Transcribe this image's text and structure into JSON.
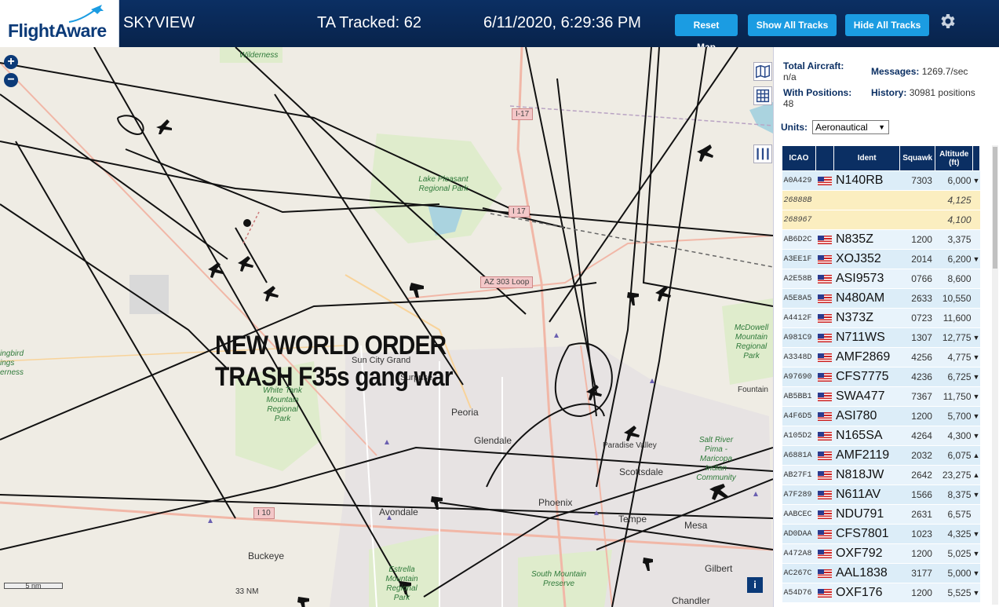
{
  "header": {
    "logo": "FlightAware",
    "title": "SKYVIEW",
    "tracked": "TA Tracked: 62",
    "datetime": "6/11/2020, 6:29:36 PM",
    "buttons": {
      "reset": "Reset Map",
      "show_all": "Show All Tracks",
      "hide_all": "Hide All Tracks"
    },
    "settings_icon": "gear-icon"
  },
  "map": {
    "overlay_text": [
      "NEW WORLD ORDER",
      "TRASH F35s gang war"
    ],
    "zoom_in": "+",
    "zoom_out": "−",
    "scale_km": "5 nm",
    "scale_nm": "33 NM",
    "info": "i",
    "labels": {
      "sun_city_grand": "Sun City Grand",
      "surprise": "Surprise",
      "peoria": "Peoria",
      "glendale": "Glendale",
      "phoenix": "Phoenix",
      "avondale": "Avondale",
      "buckeye": "Buckeye",
      "tempe": "Tempe",
      "mesa": "Mesa",
      "scottsdale": "Scottsdale",
      "paradise_valley": "Paradise Valley",
      "fountain": "Fountain",
      "gilbert": "Gilbert",
      "chandler": "Chandler"
    },
    "parks": {
      "wilderness": "Wilderness",
      "lake_pleasant": "Lake Pleasant Regional Park",
      "white_tank": "White Tank Mountain Regional Park",
      "mcdowell": "McDowell Mountain Regional Park",
      "salt_river": "Salt River Pima - Maricopa Indian Community",
      "estrella": "Estrella Mountain Regional Park",
      "south_mountain": "South Mountain Preserve",
      "hummingbird": "ingbird ings erness"
    },
    "shields": {
      "i17_a": "I-17",
      "i17_b": "I 17",
      "az303": "AZ 303 Loop",
      "i10": "I 10"
    }
  },
  "panel": {
    "total_aircraft_label": "Total Aircraft:",
    "total_aircraft_value": "n/a",
    "with_positions_label": "With Positions:",
    "with_positions_value": "48",
    "messages_label": "Messages:",
    "messages_value": "1269.7/sec",
    "history_label": "History:",
    "history_value": "30981 positions",
    "units_label": "Units:",
    "units_value": "Aeronautical",
    "table": {
      "headers": {
        "icao": "ICAO",
        "ident": "Ident",
        "squawk": "Squawk",
        "altitude": "Altitude (ft)"
      },
      "rows": [
        {
          "icao": "A0A429",
          "ident": "N140RB",
          "squawk": "7303",
          "alt": "6,000",
          "vr": "▼",
          "pos": true
        },
        {
          "icao": "26888B",
          "ident": "",
          "squawk": "",
          "alt": "4,125",
          "vr": "",
          "pos": false
        },
        {
          "icao": "268967",
          "ident": "",
          "squawk": "",
          "alt": "4,100",
          "vr": "",
          "pos": false
        },
        {
          "icao": "AB6D2C",
          "ident": "N835Z",
          "squawk": "1200",
          "alt": "3,375",
          "vr": "",
          "pos": true
        },
        {
          "icao": "A3EE1F",
          "ident": "XOJ352",
          "squawk": "2014",
          "alt": "6,200",
          "vr": "▼",
          "pos": true
        },
        {
          "icao": "A2E58B",
          "ident": "ASI9573",
          "squawk": "0766",
          "alt": "8,600",
          "vr": "",
          "pos": true
        },
        {
          "icao": "A5E8A5",
          "ident": "N480AM",
          "squawk": "2633",
          "alt": "10,550",
          "vr": "",
          "pos": true
        },
        {
          "icao": "A4412F",
          "ident": "N373Z",
          "squawk": "0723",
          "alt": "11,600",
          "vr": "",
          "pos": true
        },
        {
          "icao": "A981C9",
          "ident": "N711WS",
          "squawk": "1307",
          "alt": "12,775",
          "vr": "▼",
          "pos": true
        },
        {
          "icao": "A3348D",
          "ident": "AMF2869",
          "squawk": "4256",
          "alt": "4,775",
          "vr": "▼",
          "pos": true
        },
        {
          "icao": "A97690",
          "ident": "CFS7775",
          "squawk": "4236",
          "alt": "6,725",
          "vr": "▼",
          "pos": true
        },
        {
          "icao": "AB5BB1",
          "ident": "SWA477",
          "squawk": "7367",
          "alt": "11,750",
          "vr": "▼",
          "pos": true
        },
        {
          "icao": "A4F6D5",
          "ident": "ASI780",
          "squawk": "1200",
          "alt": "5,700",
          "vr": "▼",
          "pos": true
        },
        {
          "icao": "A105D2",
          "ident": "N165SA",
          "squawk": "4264",
          "alt": "4,300",
          "vr": "▼",
          "pos": true
        },
        {
          "icao": "A6881A",
          "ident": "AMF2119",
          "squawk": "2032",
          "alt": "6,075",
          "vr": "▲",
          "pos": true
        },
        {
          "icao": "AB27F1",
          "ident": "N818JW",
          "squawk": "2642",
          "alt": "23,275",
          "vr": "▲",
          "pos": true
        },
        {
          "icao": "A7F289",
          "ident": "N611AV",
          "squawk": "1566",
          "alt": "8,375",
          "vr": "▼",
          "pos": true
        },
        {
          "icao": "AABCEC",
          "ident": "NDU791",
          "squawk": "2631",
          "alt": "6,575",
          "vr": "",
          "pos": true
        },
        {
          "icao": "AD0DAA",
          "ident": "CFS7801",
          "squawk": "1023",
          "alt": "4,325",
          "vr": "▼",
          "pos": true
        },
        {
          "icao": "A472A8",
          "ident": "OXF792",
          "squawk": "1200",
          "alt": "5,025",
          "vr": "▼",
          "pos": true
        },
        {
          "icao": "AC267C",
          "ident": "AAL1838",
          "squawk": "3177",
          "alt": "5,000",
          "vr": "▼",
          "pos": true
        },
        {
          "icao": "A54D76",
          "ident": "OXF176",
          "squawk": "1200",
          "alt": "5,525",
          "vr": "▼",
          "pos": true
        }
      ]
    }
  },
  "colors": {
    "header_bg": "#0b2f63",
    "button": "#1b9ce2",
    "row": "#dcedf8",
    "row_nopos": "#fbeec0"
  }
}
